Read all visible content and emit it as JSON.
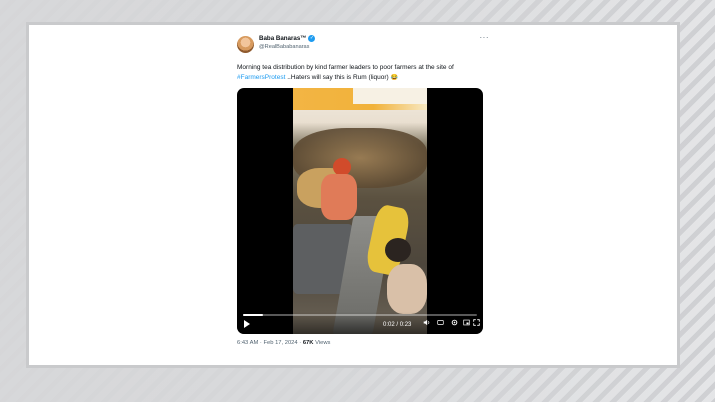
{
  "tweet": {
    "author_name": "Baba Banaras™",
    "handle": "@RealBababanaras",
    "more_label": "···",
    "text_part1": "Morning tea distribution by kind farmer leaders to poor farmers at the site of ",
    "hashtag": "#FarmersProtest",
    "text_part2": " ..Haters will say this is Rum (liquor) ",
    "emoji": "😂",
    "time": "6:43 AM",
    "separator": "·",
    "date": "Feb 17, 2024",
    "views_count": "67K",
    "views_label": "Views"
  },
  "video": {
    "current_time": "0:02",
    "time_separator": "/",
    "duration": "0:23",
    "progress_fraction": 0.087,
    "icons": [
      "play-icon",
      "volume-icon",
      "captions-icon",
      "settings-icon",
      "pip-icon",
      "fullscreen-icon"
    ]
  },
  "colors": {
    "accent": "#1d9bf0",
    "text": "#0f1419",
    "muted": "#536471"
  }
}
